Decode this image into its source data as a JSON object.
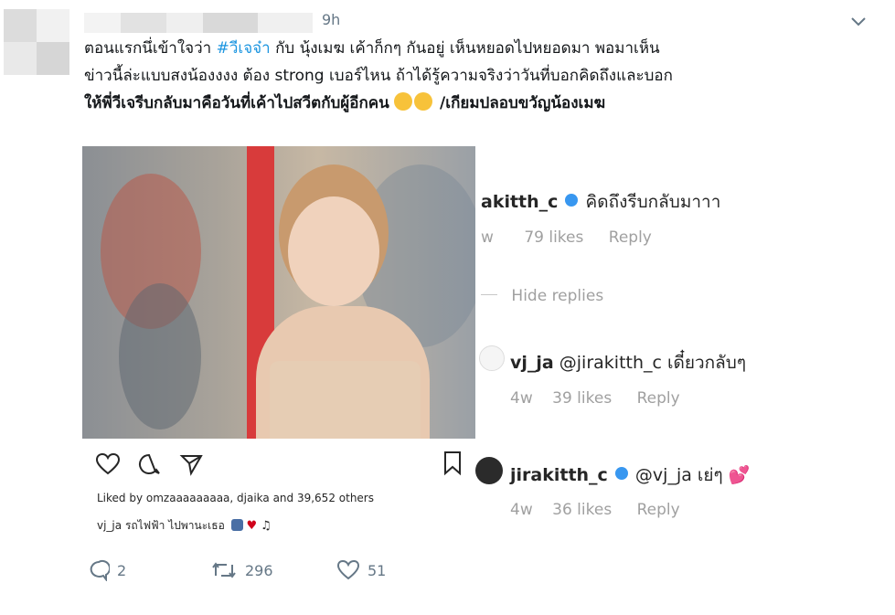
{
  "tweet": {
    "time": "9h",
    "line1_a": "ตอนแรกนึ่เข้าใจว่า ",
    "line1_tag": "#วีเจจ๋า",
    "line1_b": " กับ นุ้งเมฆ เค้าก็กๆ กันอยู่ เห็นหยอดไปหยอดมา พอมาเห็น",
    "line2": "ข่าวนี้ล่ะแบบสงน้องงงง ต้อง strong เบอร์ไหน ถ้าได้รู้ความจริงว่าวันที่บอกคิดถึงและบอก",
    "line3_a": "ให้พี่วีเจรีบกลับมาคือวันที่เค้าไปสวีตกับผู้อีกคน",
    "line3_b": " /เกียมปลอบขวัญน้องเมฆ"
  },
  "instagram": {
    "liked_by": "Liked by omzaaaaaaaaa, djaika and 39,652 others",
    "caption": "vj_ja รถไฟฟ้า ไปพานะเธอ"
  },
  "comments": {
    "c1_user": "akitth_c",
    "c1_text": "คิดถึงรีบกลับมาาา",
    "c1_age": "w",
    "c1_likes": "79 likes",
    "c1_reply": "Reply",
    "hide": "Hide replies",
    "c2_user": "vj_ja",
    "c2_text": "@jirakitth_c เดี๋ยวกลับๆ",
    "c2_age": "4w",
    "c2_likes": "39 likes",
    "c2_reply": "Reply",
    "c3_user": "jirakitth_c",
    "c3_text": "@vj_ja เย่ๆ",
    "c3_age": "4w",
    "c3_likes": "36 likes",
    "c3_reply": "Reply"
  },
  "actions": {
    "reply_count": "2",
    "retweet_count": "296",
    "like_count": "51"
  },
  "colors": {
    "link": "#1b95e0",
    "muted": "#657786",
    "verified": "#3897f0"
  }
}
